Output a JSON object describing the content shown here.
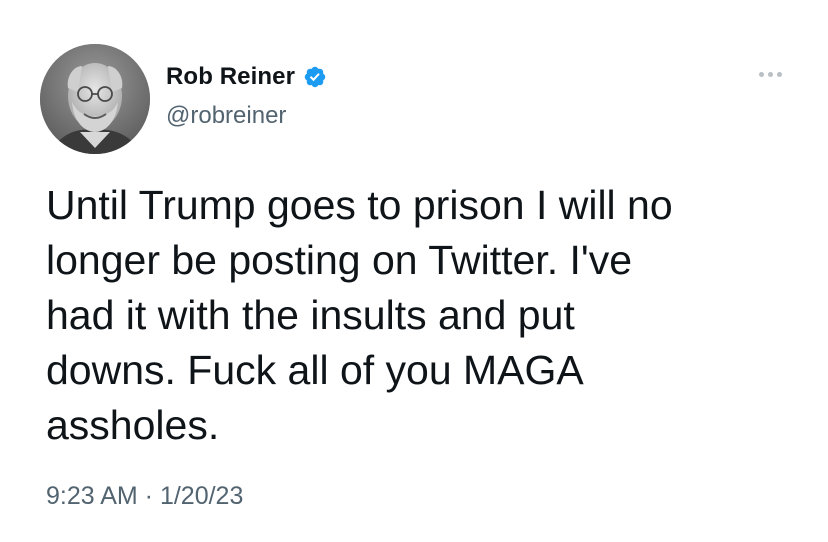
{
  "tweet": {
    "author": {
      "display_name": "Rob Reiner",
      "handle": "@robreiner",
      "verified": true
    },
    "text": "Until Trump goes to prison I will no\nlonger be posting on Twitter. I've\nhad it with the insults and put\ndowns. Fuck all of you MAGA\nassholes.",
    "timestamp": "9:23 AM · 1/20/23"
  },
  "icons": {
    "verified": "verified-badge-icon",
    "more": "more-dots-icon"
  },
  "colors": {
    "primary_text": "#0f1419",
    "secondary_text": "#536471",
    "verified_blue": "#1d9bf0",
    "background": "#ffffff"
  }
}
